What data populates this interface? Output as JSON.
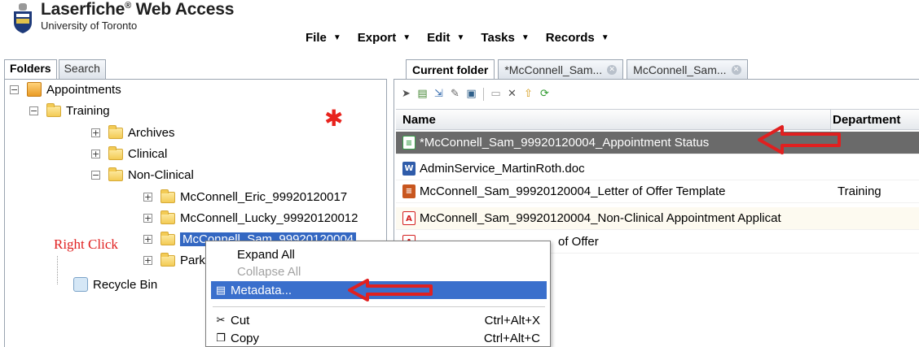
{
  "header": {
    "app_name": "Laserfiche",
    "app_suffix": "Web Access",
    "org": "University of Toronto"
  },
  "menubar": {
    "items": [
      {
        "label": "File"
      },
      {
        "label": "Export"
      },
      {
        "label": "Edit"
      },
      {
        "label": "Tasks"
      },
      {
        "label": "Records"
      }
    ]
  },
  "left_tabs": [
    {
      "label": "Folders",
      "active": true
    },
    {
      "label": "Search",
      "active": false
    }
  ],
  "tree": {
    "root": "Appointments",
    "training": "Training",
    "archives": "Archives",
    "clinical": "Clinical",
    "non_clinical": "Non-Clinical",
    "eric": "McConnell_Eric_99920120017",
    "lucky": "McConnell_Lucky_99920120012",
    "sam": "McConnell_Sam_99920120004",
    "parker": "Parke",
    "recycle": "Recycle Bin"
  },
  "annotation": {
    "right_click": "Right Click",
    "star_color": "#e8231d",
    "arrow_color": "#e02020"
  },
  "right_tabs": [
    {
      "label": "Current folder",
      "active": true
    },
    {
      "label": "*McConnell_Sam...",
      "active": false
    },
    {
      "label": "McConnell_Sam...",
      "active": false
    }
  ],
  "grid": {
    "columns": {
      "name": "Name",
      "department": "Department"
    },
    "rows": [
      {
        "name": "*McConnell_Sam_99920120004_Appointment Status",
        "department": "",
        "icon": "form-icon"
      },
      {
        "name": "AdminService_MartinRoth.doc",
        "department": "",
        "icon": "word-doc-icon"
      },
      {
        "name": "McConnell_Sam_99920120004_Letter of Offer Template",
        "department": "Training",
        "icon": "document-icon"
      },
      {
        "name": "McConnell_Sam_99920120004_Non-Clinical Appointment Applicat",
        "department": "",
        "icon": "pdf-icon"
      },
      {
        "name": "of Offer",
        "department": "",
        "icon": "pdf-icon"
      }
    ]
  },
  "context_menu": {
    "expand_all": "Expand All",
    "collapse_all": "Collapse All",
    "metadata": "Metadata...",
    "cut": "Cut",
    "cut_shortcut": "Ctrl+Alt+X",
    "copy": "Copy",
    "copy_shortcut": "Ctrl+Alt+C"
  }
}
